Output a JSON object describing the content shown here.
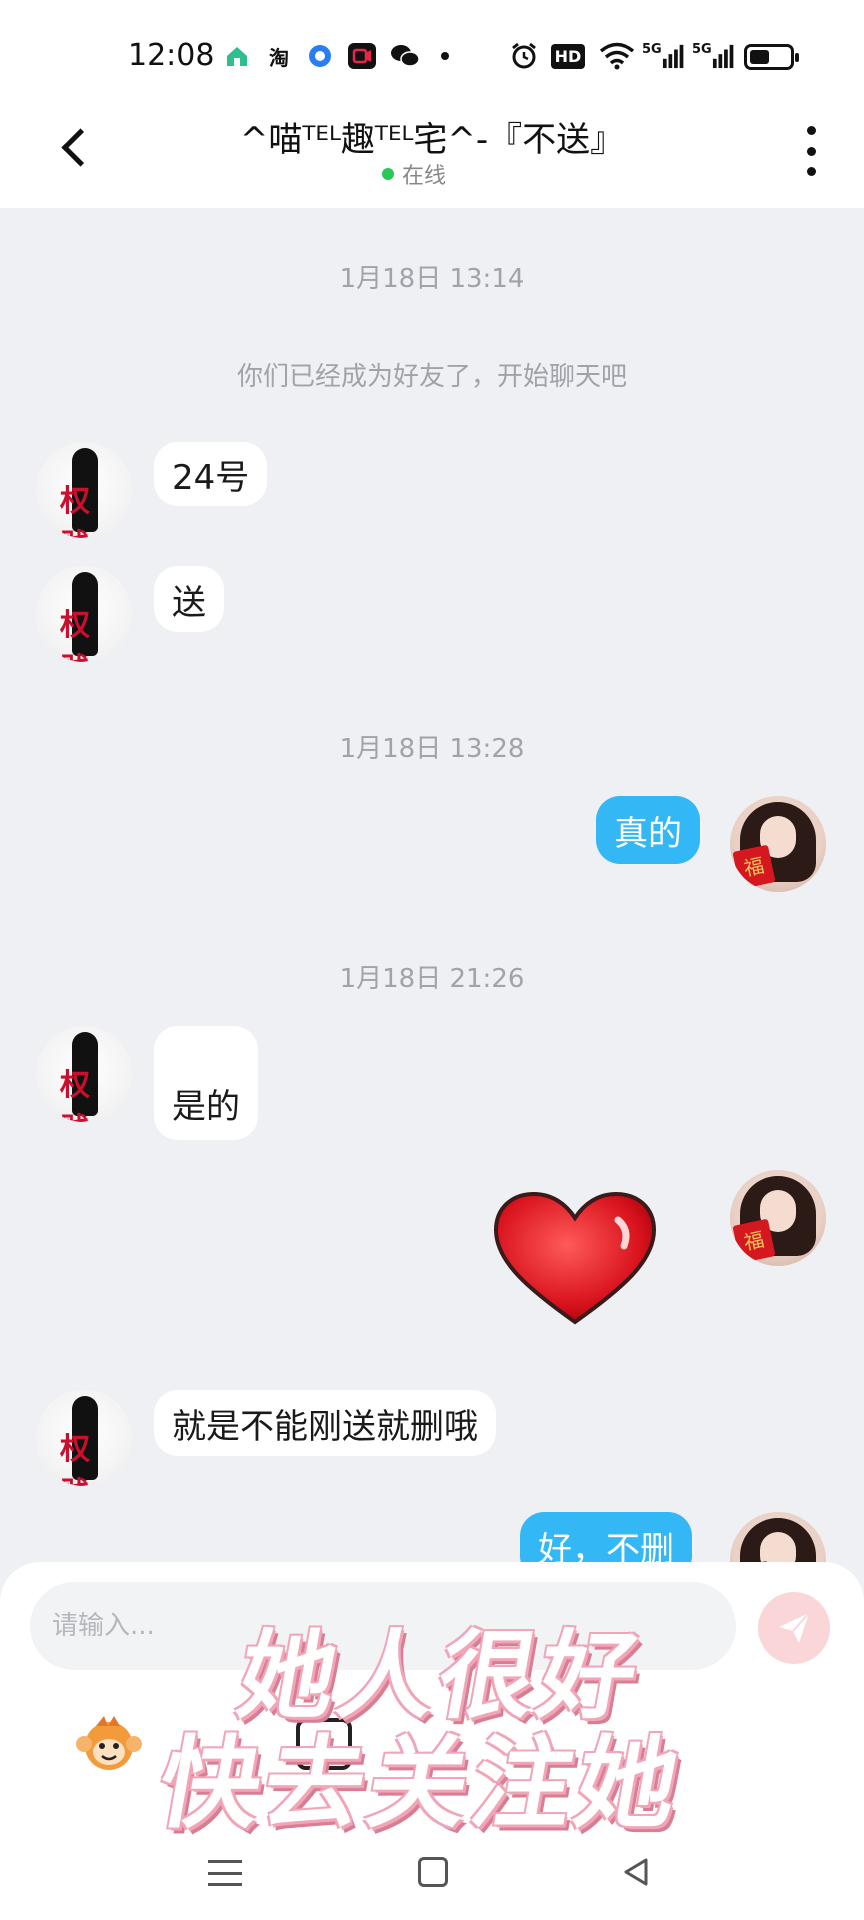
{
  "status_bar": {
    "time": "12:08",
    "icons": [
      "home-app-icon",
      "taobao-icon",
      "browser-icon",
      "video-icon",
      "wechat-icon",
      "dot-icon",
      "alarm-icon",
      "hd-icon",
      "wifi-icon",
      "5g-signal-icon",
      "5g-signal-icon",
      "battery-icon"
    ],
    "taobao_label": "淘",
    "hd_label": "HD",
    "signal_label_1": "5G",
    "signal_label_2": "5G",
    "battery_level": 0.5
  },
  "header": {
    "title": "^喵ᵀᴱᴸ趣ᵀᴱᴸ宅^-『不送』",
    "status": "在线"
  },
  "messages": [
    {
      "type": "time",
      "text": "1月18日 13:14"
    },
    {
      "type": "system",
      "text": "你们已经成为好友了，开始聊天吧"
    },
    {
      "type": "incoming",
      "text": "24号"
    },
    {
      "type": "incoming",
      "text": "送"
    },
    {
      "type": "time",
      "text": "1月18日 13:28"
    },
    {
      "type": "outgoing",
      "text": "真的"
    },
    {
      "type": "time",
      "text": "1月18日 21:26"
    },
    {
      "type": "incoming",
      "text": "是的"
    },
    {
      "type": "outgoing_sticker",
      "sticker": "red-heart-sticker"
    },
    {
      "type": "incoming",
      "text": "就是不能刚送就删哦"
    },
    {
      "type": "outgoing",
      "text": "好，不删"
    }
  ],
  "avatars": {
    "left_brand_text": "权贱",
    "right_card_text": "福"
  },
  "input": {
    "placeholder": "请输入..."
  },
  "overlay_caption": {
    "line1": "她人很好",
    "line2": "快去关注她"
  },
  "colors": {
    "outgoing_bubble": "#33b8f5",
    "incoming_bubble": "#ffffff",
    "chat_background": "#eff0f4",
    "online_dot": "#2ac759",
    "send_button": "#fbd6d8"
  }
}
